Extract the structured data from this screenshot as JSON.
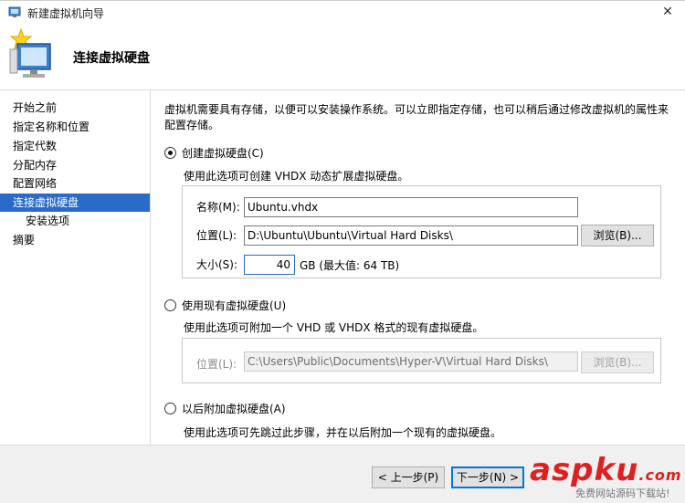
{
  "window": {
    "title": "新建虚拟机向导",
    "close_glyph": "✕"
  },
  "header": {
    "page_title": "连接虚拟硬盘"
  },
  "nav": {
    "items": [
      {
        "label": "开始之前"
      },
      {
        "label": "指定名称和位置"
      },
      {
        "label": "指定代数"
      },
      {
        "label": "分配内存"
      },
      {
        "label": "配置网络"
      },
      {
        "label": "连接虚拟硬盘",
        "active": true
      },
      {
        "label": "安装选项",
        "sub": true
      },
      {
        "label": "摘要"
      }
    ]
  },
  "content": {
    "description": "虚拟机需要具有存储，以便可以安装操作系统。可以立即指定存储，也可以稍后通过修改虚拟机的属性来配置存储。",
    "option_create": {
      "label": "创建虚拟硬盘(C)",
      "selected": true,
      "hint": "使用此选项可创建 VHDX 动态扩展虚拟硬盘。",
      "name_label": "名称(M):",
      "name_value": "Ubuntu.vhdx",
      "location_label": "位置(L):",
      "location_value": "D:\\Ubuntu\\Ubuntu\\Virtual Hard Disks\\",
      "browse_label": "浏览(B)...",
      "size_label": "大小(S):",
      "size_value": "40",
      "size_unit": "GB (最大值: 64 TB)"
    },
    "option_existing": {
      "label": "使用现有虚拟硬盘(U)",
      "selected": false,
      "hint": "使用此选项可附加一个 VHD 或 VHDX 格式的现有虚拟硬盘。",
      "location_label": "位置(L):",
      "location_value": "C:\\Users\\Public\\Documents\\Hyper-V\\Virtual Hard Disks\\",
      "browse_label": "浏览(B)..."
    },
    "option_later": {
      "label": "以后附加虚拟硬盘(A)",
      "selected": false,
      "hint": "使用此选项可先跳过此步骤，并在以后附加一个现有的虚拟硬盘。"
    }
  },
  "footer": {
    "prev_label": "< 上一步(P)",
    "next_label": "下一步(N) >"
  },
  "watermark": {
    "brand_a": "asp",
    "brand_b": "ku",
    "brand_c": ".com",
    "subtitle": "免费网站源码下载站!"
  },
  "colors": {
    "accent": "#2a6bc7",
    "watermark_red": "#e02020"
  }
}
